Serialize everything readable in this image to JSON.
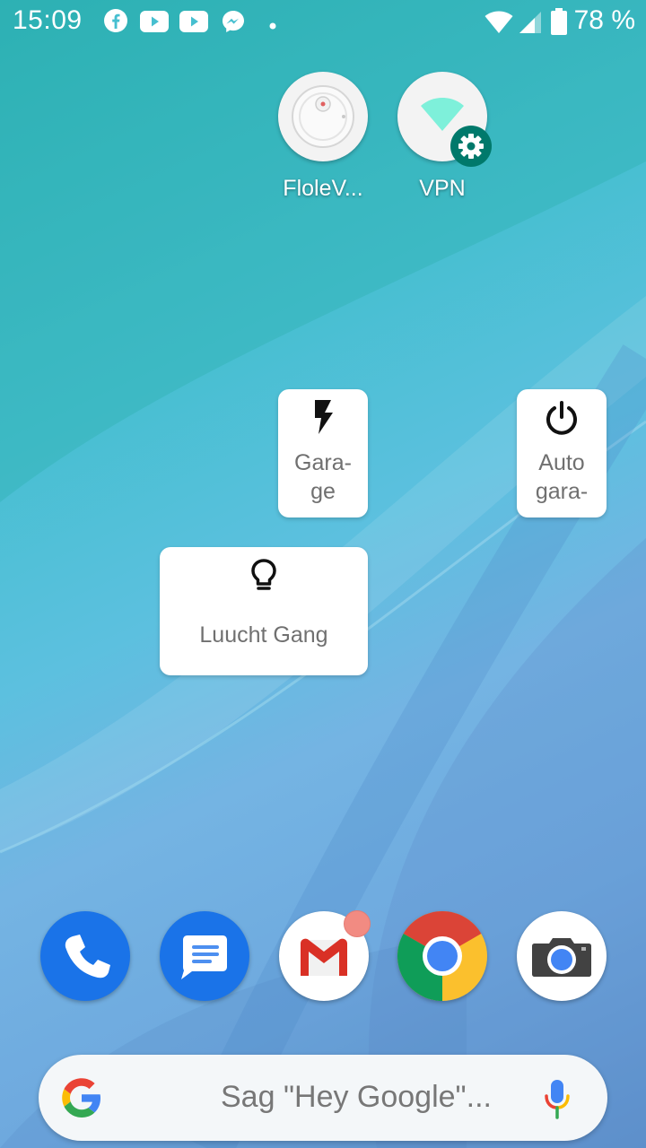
{
  "status_bar": {
    "time": "15:09",
    "notification_icons": [
      "facebook-icon",
      "youtube-icon",
      "youtube-icon",
      "messenger-icon",
      "more-notifications-dot"
    ],
    "battery_percent": "78 %"
  },
  "shortcuts": [
    {
      "label": "FloleV...",
      "icon": "robot-vacuum-icon"
    },
    {
      "label": "VPN",
      "icon": "vpn-settings-icon"
    }
  ],
  "widgets": {
    "garage": {
      "label": "Gara-\nge",
      "icon": "flash-icon"
    },
    "auto_garage": {
      "label": "Auto\ngara-",
      "icon": "power-icon"
    },
    "luucht_gang": {
      "label": "Luucht Gang",
      "icon": "lightbulb-icon"
    }
  },
  "dock": [
    "phone-icon",
    "messages-icon",
    "gmail-icon",
    "chrome-icon",
    "camera-icon"
  ],
  "search": {
    "placeholder": "Sag \"Hey Google\"..."
  },
  "colors": {
    "dock_blue": "#1a73e8",
    "vpn_badge": "#00796b",
    "gmail_badge": "#f28b82"
  }
}
